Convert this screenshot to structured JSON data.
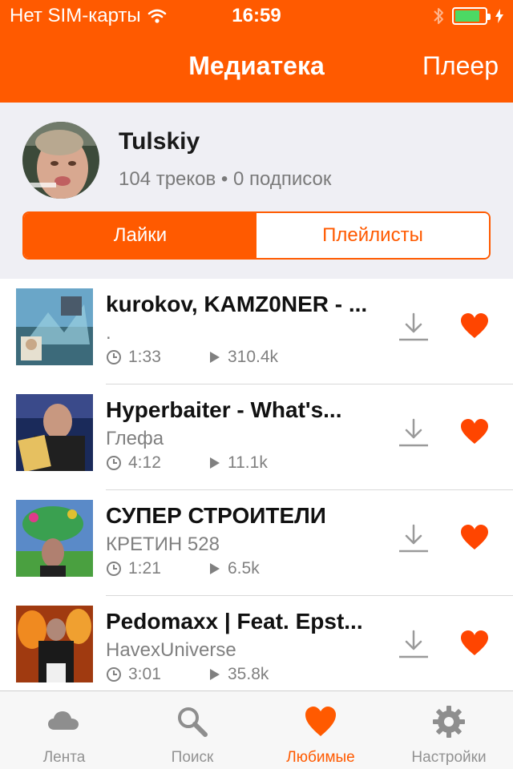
{
  "status_bar": {
    "carrier": "Нет SIM-карты",
    "time": "16:59",
    "battery_level": 0.85
  },
  "nav": {
    "title": "Медиатека",
    "right_button": "Плеер"
  },
  "profile": {
    "username": "Tulskiy",
    "stats": "104 треков • 0 подписок"
  },
  "segment": {
    "likes": "Лайки",
    "playlists": "Плейлисты"
  },
  "tracks": [
    {
      "title": "kurokov, KAMZ0NER - ...",
      "artist": ".",
      "duration": "1:33",
      "plays": "310.4k"
    },
    {
      "title": "Hyperbaiter - What's...",
      "artist": "Глефа",
      "duration": "4:12",
      "plays": "11.1k"
    },
    {
      "title": "СУПЕР СТРОИТЕЛИ",
      "artist": "КРЕТИН 528",
      "duration": "1:21",
      "plays": "6.5k"
    },
    {
      "title": "Pedomaxx | Feat. Epst...",
      "artist": "HavexUniverse",
      "duration": "3:01",
      "plays": "35.8k"
    }
  ],
  "tabs": [
    {
      "label": "Лента",
      "icon": "cloud-icon"
    },
    {
      "label": "Поиск",
      "icon": "search-icon"
    },
    {
      "label": "Любимые",
      "icon": "heart-icon",
      "active": true
    },
    {
      "label": "Настройки",
      "icon": "gear-icon"
    }
  ],
  "colors": {
    "accent": "#ff5a00",
    "heart": "#ff4500",
    "tab_inactive": "#929292"
  }
}
